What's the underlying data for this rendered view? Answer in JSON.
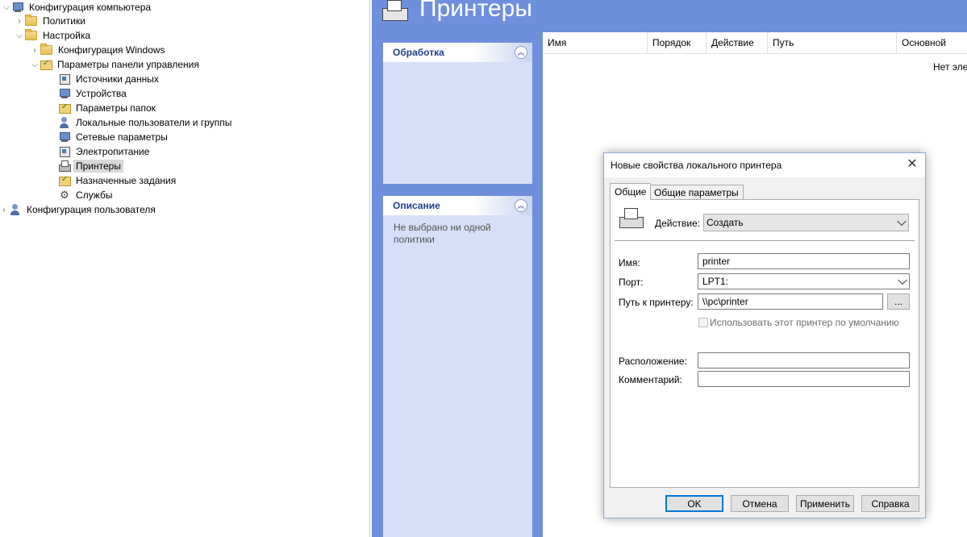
{
  "tree": {
    "items": [
      {
        "label": "Конфигурация компьютера",
        "icon": "computer-icon",
        "state": "expanded"
      },
      {
        "label": "Политики",
        "icon": "folder-icon",
        "state": "collapsed"
      },
      {
        "label": "Настройка",
        "icon": "folder-icon",
        "state": "expanded"
      },
      {
        "label": "Конфигурация Windows",
        "icon": "folder-icon",
        "state": "collapsed"
      },
      {
        "label": "Параметры панели управления",
        "icon": "control-panel-icon",
        "state": "expanded"
      },
      {
        "label": "Источники данных",
        "icon": "data-sources-icon"
      },
      {
        "label": "Устройства",
        "icon": "devices-icon"
      },
      {
        "label": "Параметры папок",
        "icon": "folder-options-icon"
      },
      {
        "label": "Локальные пользователи и группы",
        "icon": "local-users-icon"
      },
      {
        "label": "Сетевые параметры",
        "icon": "network-icon"
      },
      {
        "label": "Электропитание",
        "icon": "power-icon"
      },
      {
        "label": "Принтеры",
        "icon": "printer-icon",
        "selected": true
      },
      {
        "label": "Назначенные задания",
        "icon": "scheduled-tasks-icon"
      },
      {
        "label": "Службы",
        "icon": "services-gear-icon"
      },
      {
        "label": "Конфигурация пользователя",
        "icon": "user-config-icon",
        "state": "collapsed"
      }
    ]
  },
  "header": {
    "title": "Принтеры"
  },
  "panels": {
    "processing": {
      "title": "Обработка"
    },
    "description": {
      "title": "Описание",
      "text": "Не выбрано ни одной политики"
    }
  },
  "listview": {
    "columns": [
      "Имя",
      "Порядок",
      "Действие",
      "Путь",
      "Основной"
    ],
    "empty_text": "Нет эле"
  },
  "dialog": {
    "title": "Новые свойства локального принтера",
    "close_glyph": "✕",
    "tabs": [
      "Общие",
      "Общие параметры"
    ],
    "action_label": "Действие:",
    "action_value": "Создать",
    "name_label": "Имя:",
    "name_value": "printer",
    "port_label": "Порт:",
    "port_value": "LPT1:",
    "path_label": "Путь к принтеру:",
    "path_value": "\\\\pc\\printer",
    "browse_label": "...",
    "default_label": "Использовать этот принтер по умолчанию",
    "location_label": "Расположение:",
    "location_value": "",
    "comment_label": "Комментарий:",
    "comment_value": "",
    "buttons": {
      "ok": "OK",
      "cancel": "Отмена",
      "apply": "Применить",
      "help": "Справка"
    }
  },
  "colors": {
    "accent": "#6e8fdc",
    "panel": "#d6dff7",
    "panel_title": "#1f3f8c",
    "selection": "#d9d9d9"
  }
}
